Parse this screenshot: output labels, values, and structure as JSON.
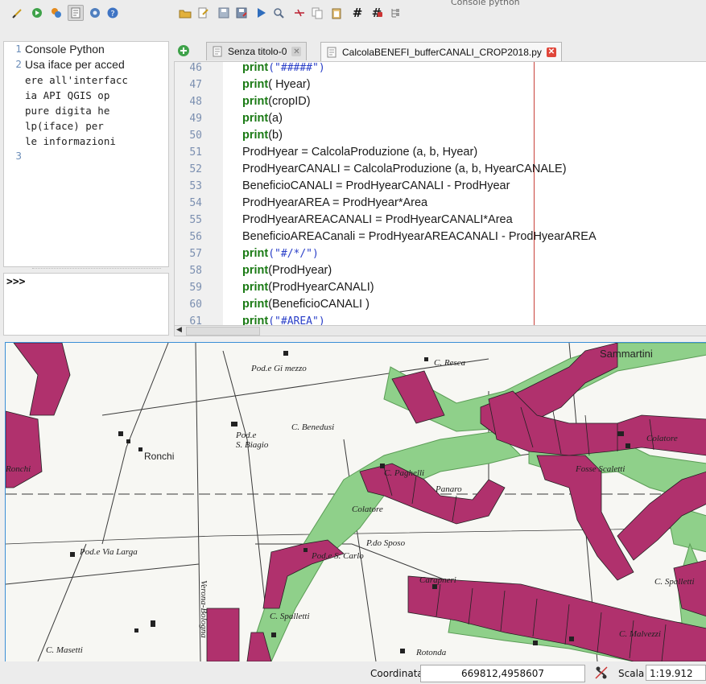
{
  "panel": {
    "title": "Console python"
  },
  "toolbar_left": [
    {
      "icon": "clear-console-icon"
    },
    {
      "icon": "run-command-icon"
    },
    {
      "icon": "import-class-icon"
    },
    {
      "icon": "show-editor-icon",
      "pressed": true
    },
    {
      "icon": "settings-icon"
    },
    {
      "icon": "help-icon"
    }
  ],
  "toolbar_editor": [
    {
      "icon": "open-file-icon"
    },
    {
      "icon": "open-in-external-editor-icon"
    },
    {
      "icon": "save-icon"
    },
    {
      "icon": "save-as-icon"
    },
    {
      "icon": "run-script-icon"
    },
    {
      "icon": "find-icon"
    },
    {
      "icon": "cut-icon"
    },
    {
      "icon": "copy-icon"
    },
    {
      "icon": "paste-icon"
    },
    {
      "icon": "comment-icon",
      "glyph": "#"
    },
    {
      "icon": "uncomment-icon",
      "glyph": "#"
    },
    {
      "icon": "object-inspector-icon"
    }
  ],
  "output": {
    "lines": [
      {
        "num": "1",
        "text": "Console Python",
        "sans": true
      },
      {
        "num": "2",
        "text": "Usa iface per acced",
        "sans": true
      },
      {
        "num": "",
        "text": "ere all'interfacc"
      },
      {
        "num": "",
        "text": "ia API QGIS op"
      },
      {
        "num": "",
        "text": "pure digita he"
      },
      {
        "num": "",
        "text": "lp(iface) per"
      },
      {
        "num": "",
        "text": "le informazioni"
      },
      {
        "num": "3",
        "text": ""
      }
    ]
  },
  "input": {
    "prompt": ">>>"
  },
  "tabs": [
    {
      "label": "Senza titolo-0",
      "active": false
    },
    {
      "label": "CalcolaBENEFI_bufferCANALI_CROP2018.py",
      "active": true
    }
  ],
  "code": {
    "lines": [
      {
        "num": "46",
        "kw": "print",
        "rest": "",
        "str": "(\"#####\")"
      },
      {
        "num": "47",
        "kw": "print",
        "rest": "( Hyear)"
      },
      {
        "num": "48",
        "kw": "print",
        "rest": "(cropID)"
      },
      {
        "num": "49",
        "kw": "print",
        "rest": "(a)"
      },
      {
        "num": "50",
        "kw": "print",
        "rest": "(b)"
      },
      {
        "num": "51",
        "kw": "",
        "rest": "ProdHyear = CalcolaProduzione (a, b, Hyear)"
      },
      {
        "num": "52",
        "kw": "",
        "rest": "ProdHyearCANALI = CalcolaProduzione (a, b, HyearCANALE)"
      },
      {
        "num": "53",
        "kw": "",
        "rest": "BeneficioCANALI = ProdHyearCANALI - ProdHyear"
      },
      {
        "num": "54",
        "kw": "",
        "rest": "ProdHyearAREA = ProdHyear*Area"
      },
      {
        "num": "55",
        "kw": "",
        "rest": "ProdHyearAREACANALI = ProdHyearCANALI*Area"
      },
      {
        "num": "56",
        "kw": "",
        "rest": "BeneficioAREACanali = ProdHyearAREACANALI - ProdHyearAREA"
      },
      {
        "num": "57",
        "kw": "print",
        "rest": "",
        "str": "(\"#/*/\")"
      },
      {
        "num": "58",
        "kw": "print",
        "rest": "(ProdHyear)"
      },
      {
        "num": "59",
        "kw": "print",
        "rest": "(ProdHyearCANALI)"
      },
      {
        "num": "60",
        "kw": "print",
        "rest": "(BeneficioCANALI )"
      },
      {
        "num": "61",
        "kw": "print",
        "rest": "",
        "str": "(\"#AREA\")"
      }
    ]
  },
  "map": {
    "labels": [
      "C. Resca",
      "Sammartini",
      "Pod.e Gi mezzo",
      "C. Benedusi",
      "Pod.e",
      "S. Biagio",
      "Ronchi",
      "Fosse Scaletti",
      "Colatore",
      "C. Paghelli",
      "Panaro",
      "Colatore",
      "Pod.e Via Larga",
      "Pod.e S. Carlo",
      "P.do Sposo",
      "Carapneri",
      "C. Spalletti",
      "C. Spalletti",
      "Verona-Bologna",
      "C. Masetti",
      "Rotonda",
      "C. Malvezzi",
      "Ronchi"
    ]
  },
  "status": {
    "coord_label": "Coordinata",
    "coord_value": "669812,4958607",
    "scale_label": "Scala",
    "scale_value": "1:19.912"
  },
  "colors": {
    "buffer_magenta": "#b0316d",
    "buffer_green": "#8fd08a",
    "selection_border": "#3a8ed6",
    "edge_line": "#c8413a"
  }
}
